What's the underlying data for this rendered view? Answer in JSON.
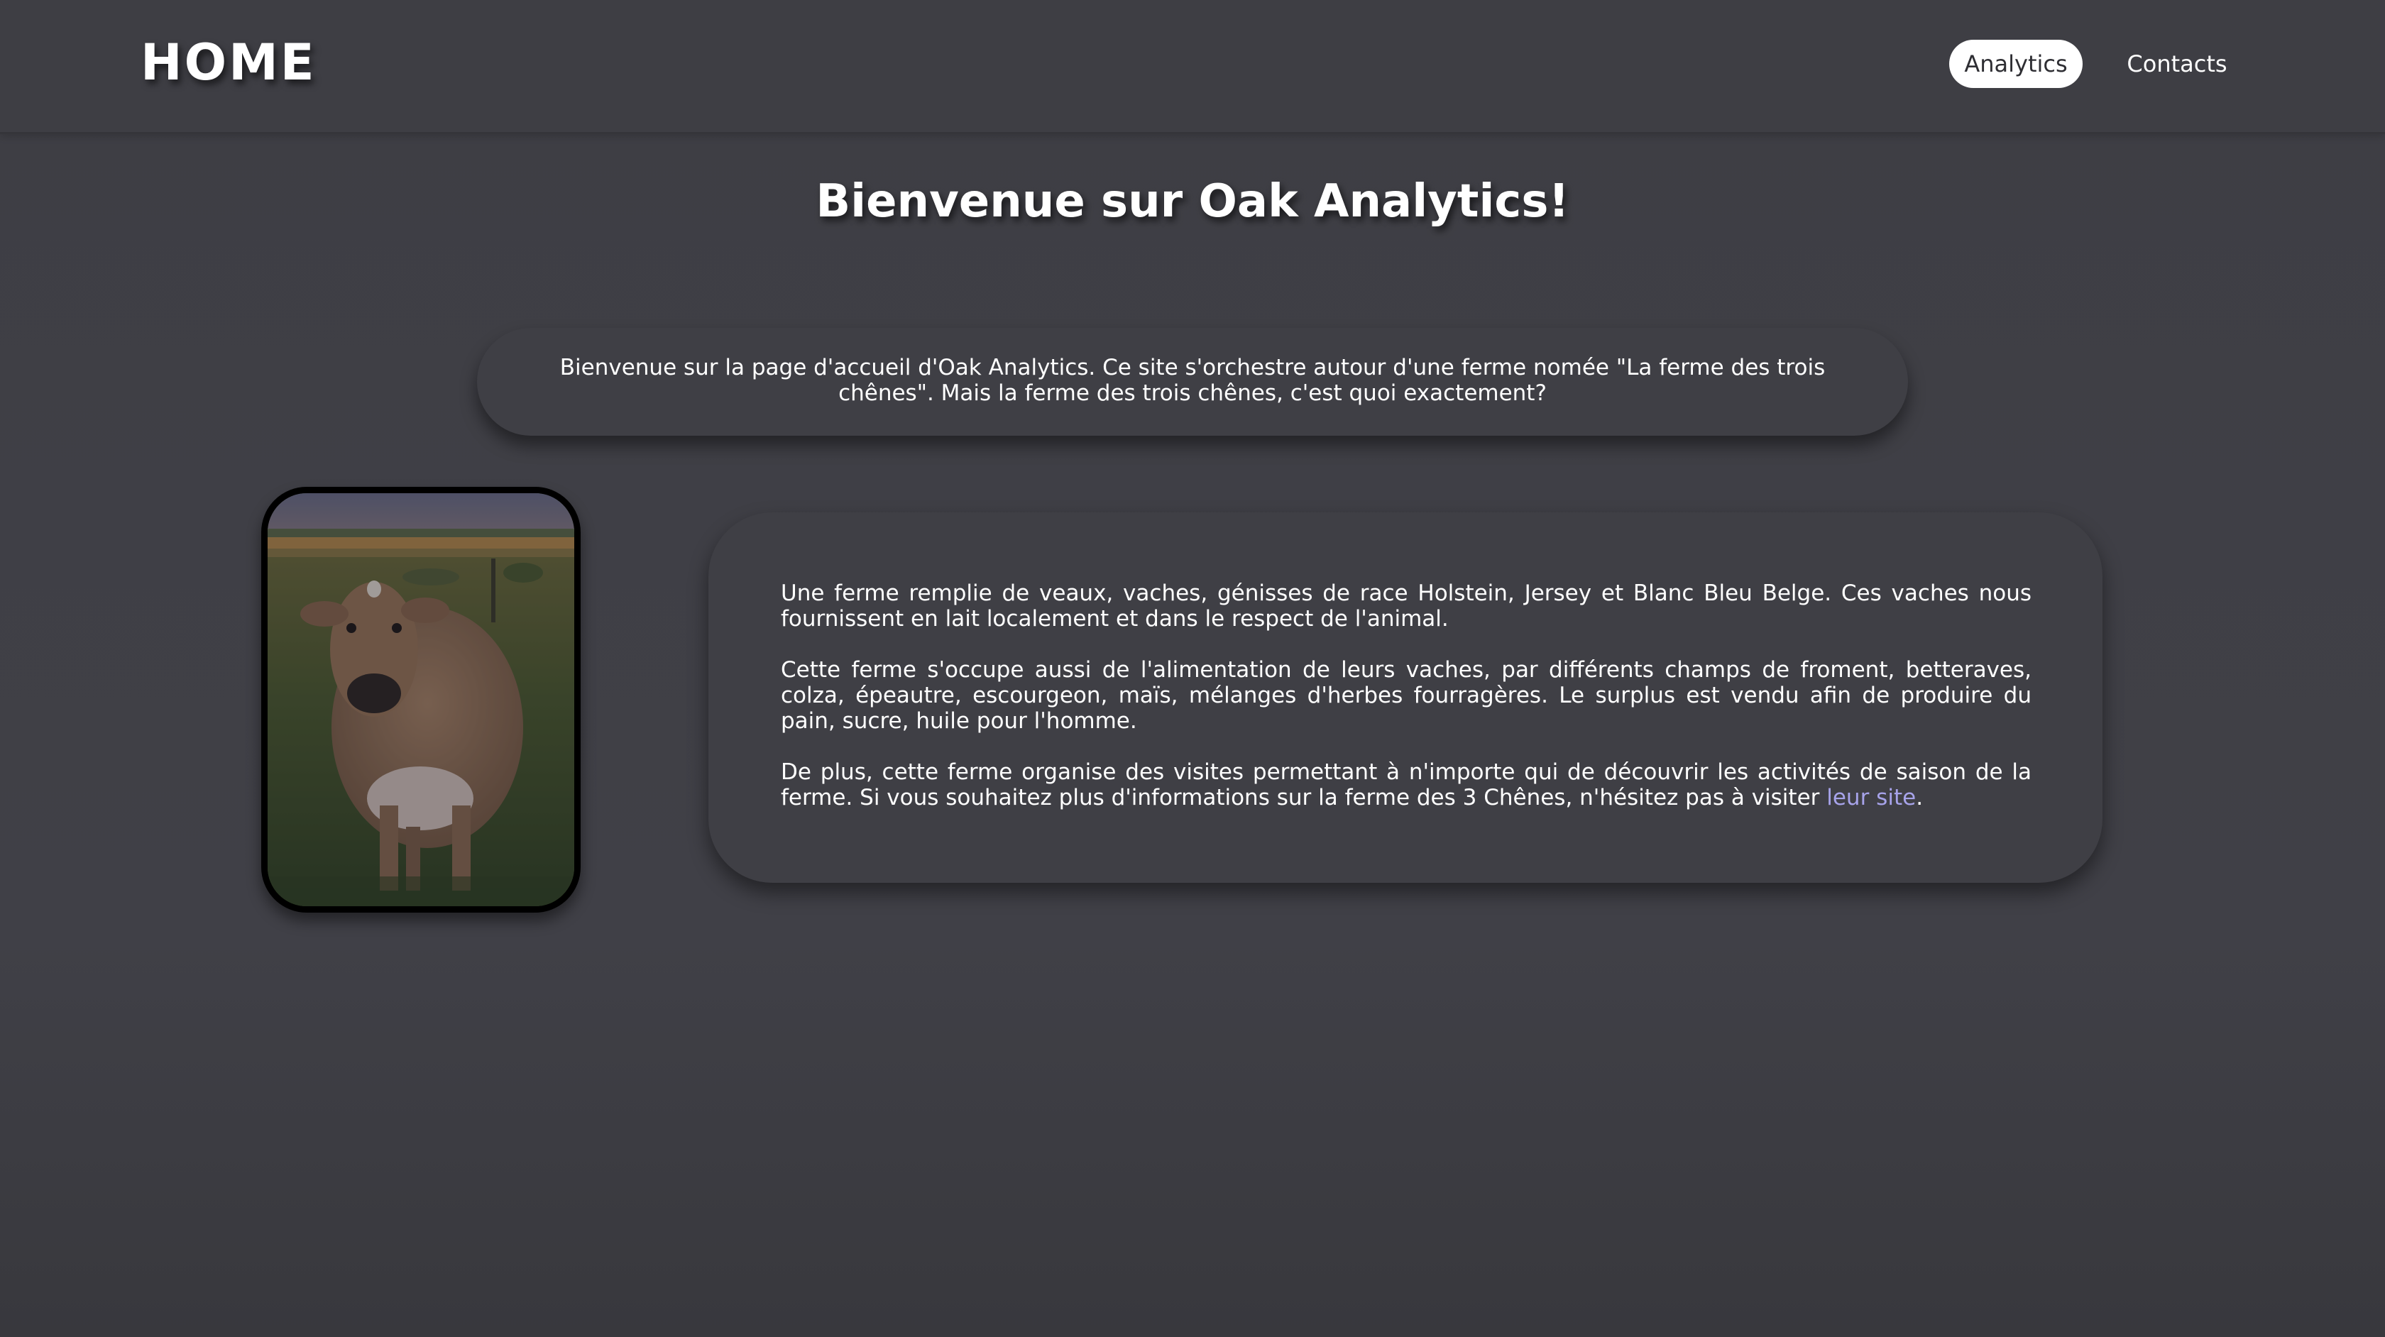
{
  "nav": {
    "brand": "HOME",
    "items": [
      {
        "label": "Analytics",
        "active": true
      },
      {
        "label": "Contacts",
        "active": false
      }
    ]
  },
  "main": {
    "title": "Bienvenue sur Oak Analytics!",
    "intro": "Bienvenue sur la page d'accueil d'Oak Analytics. Ce site s'orchestre autour d'une ferme nomée \"La ferme des trois chênes\". Mais la ferme des trois chênes, c'est quoi exactement?",
    "paragraphs": [
      "Une ferme remplie de veaux, vaches, génisses de race Holstein, Jersey et Blanc Bleu Belge. Ces vaches nous fournissent en lait localement et dans le respect de l'animal.",
      "Cette ferme s'occupe aussi de l'alimentation de leurs vaches, par différents champs de froment, betteraves, colza, épeautre, escourgeon, maïs, mélanges d'herbes fourragères. Le surplus est vendu afin de produire du pain, sucre, huile pour l'homme."
    ],
    "last_paragraph_text": "De plus, cette ferme organise des visites permettant à n'importe qui de découvrir les activités de saison de la ferme. Si vous souhaitez plus d'informations sur la ferme des 3 Chênes, n'hésitez pas à visiter ",
    "link_label": "leur site",
    "last_paragraph_end": "."
  },
  "colors": {
    "background": "#3e3e44",
    "card": "#3f3f45",
    "link": "#a7a3ea",
    "active_nav_bg": "#ffffff"
  }
}
